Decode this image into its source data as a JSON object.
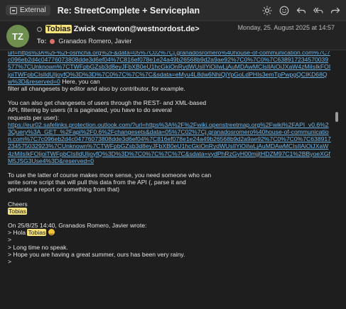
{
  "topbar": {
    "badge": "External",
    "subject": "Re: StreetComplete + Serviceplan",
    "tools": [
      "brightness-icon",
      "emoji-icon",
      "reply-icon",
      "reply-all-icon",
      "forward-icon"
    ]
  },
  "header": {
    "avatar_initials": "TZ",
    "from_highlight": "Tobias",
    "from_rest": "Zwick <newton@westnordost.de>",
    "date": "Monday, 25. August 2025 at 14:57",
    "to_label": "To:",
    "to_recipient": "Granados Romero, Javier"
  },
  "body": {
    "link1": "url=https%3A%2F%2Fosmcha.org%2F&data=05%7C02%7Cj.granadosromero%40house-of-communication.com%7C7c096eb2d4c04776073808dde3d6ef04%7C816ef078e1e24a49b26568b9d2a9ae92%7C0%7C0%7C638917234570039577%7CUnknown%7CTWFpbGZsb3d8eyJFbXB0eU1hcGkiOnRydWUsIlYiOiIwLjAuMDAwMCIsIlAiOiJXaW4zMiIsIkFOIjoiTWFpbCIsIldUIjoyfQ%3D%3D%7C0%7C%7C%7C&sdata=eMyu4L8dw6NhiQjYpGoLdPHIs3emTpPwpgQCIKD68Qw%3D&reserved=0",
    "after_link1": " Here, you can",
    "line_filter": "filter all changesets by editor and also by contributor, for example.",
    "para2_l1": "You can also get changesets of users through the REST- and XML-based",
    "para2_l2": "API, filtering by users (it is paginated, you have to do several",
    "para2_l3": "requests per user):",
    "link2": "https://eur02.safelinks.protection.outlook.com/?url=https%3A%2F%2Fwiki.openstreetmap.org%2Fwiki%2FAPI_v0.6%23Query%3A_GET_%2Fapi%2F0.6%2Fchangesets&data=05%7C02%7Cj.granadosromero%40house-of-communication.com%7C7c096eb2d4c04776073808dde3d6ef04%7C816ef078e1e24a49b26568b9d2a9ae92%7C0%7C0%7C638917234575032923%7CUnknown%7CTWFpbGZsb3d8eyJFbXB0eU1hcGkiOnRydWUsIlYiOiIwLjAuMDAwMCIsIlAiOiJXaW4zMiIsIkFOIjoiTWFpbCIsIldUIjoyfQ%3D%3D%7C0%7C%7C%7C&sdata=vydPhRzGyH00mjjtHDZM97C1%2BByoeXGfM5JSG3Use4%3D&reserved=0",
    "para3_l1": "To use the latter of course makes more sense, you need someone who can",
    "para3_l2": "write some script that will pull this data from the API (, parse it and",
    "para3_l3": "generate a report or something from that)",
    "cheers": "Cheers",
    "signature": "Tobias",
    "quote_header": "On 25/8/25 14:40, Granados Romero, Javier wrote:",
    "quote_hola": "> Hola ",
    "quote_name": "Tobias",
    "quote_gt1": ">",
    "quote_l1": "> Long time no speak.",
    "quote_l2": "> Hope you are having a great summer, ours has been very rainy.",
    "quote_gt2": ">"
  },
  "colors": {
    "link": "#6fb6e8",
    "highlight": "#f6e27a",
    "avatar": "#6f8f4e"
  }
}
